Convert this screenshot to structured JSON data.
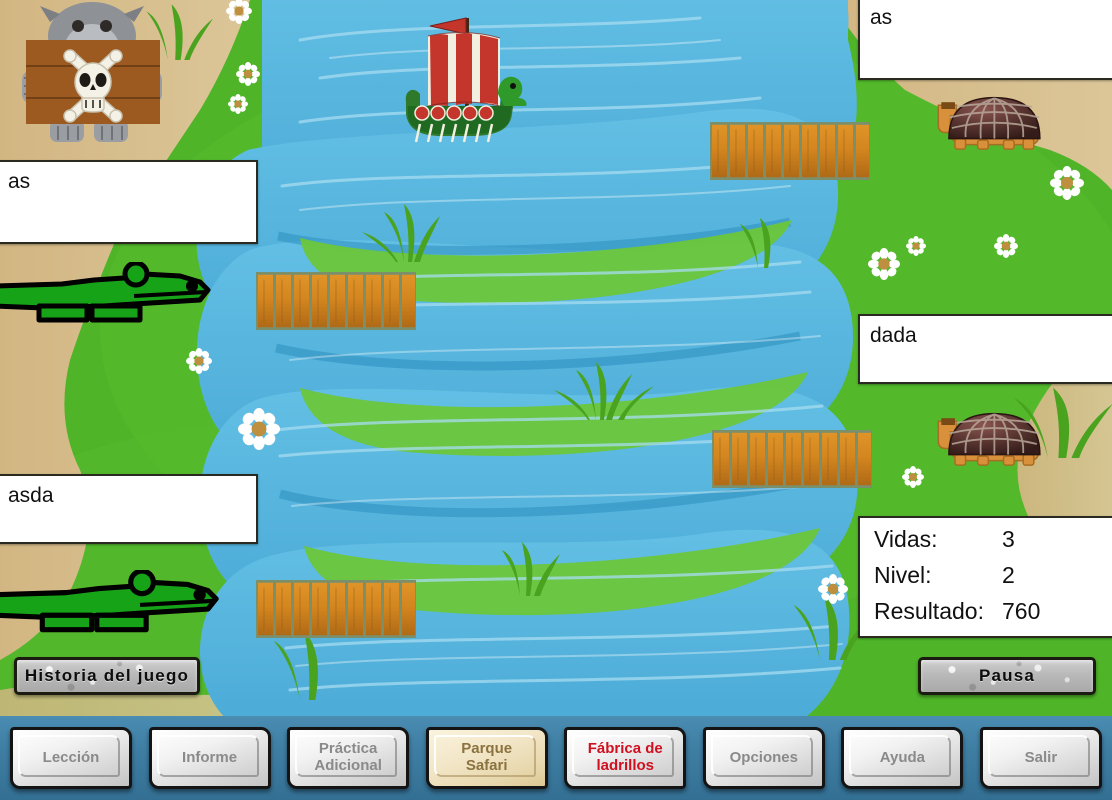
{
  "app": {
    "title": "Parque Safari",
    "scene_name": "river-crossing-safari-scene"
  },
  "colors": {
    "grass": "#4fb428",
    "grass_light": "#6cc63a",
    "sand": "#d9b687",
    "water": "#5cb8e0",
    "water_light": "#9bd8ef",
    "water_deep": "#2e8fbf",
    "bridge_plank": "#d4861f",
    "bridge_plank_dark": "#b06a16",
    "toolbar": "#3d7fa6",
    "active_tab": "#f0e2bb",
    "red_text": "#d01020",
    "panel_bg": "#ffffff",
    "panel_border": "#2a2a20",
    "turtle_shell": "#4a2b28",
    "turtle_body": "#d9903a",
    "croc_body": "#17a318",
    "ape_body": "#8e9196",
    "sign_wood": "#9c5a21"
  },
  "word_boxes": [
    {
      "id": "left-1",
      "value": "as",
      "placeholder": ""
    },
    {
      "id": "left-2",
      "value": "asda",
      "placeholder": ""
    },
    {
      "id": "right-1",
      "value": "as",
      "placeholder": ""
    },
    {
      "id": "right-2",
      "value": "dada",
      "placeholder": ""
    }
  ],
  "score_panel": {
    "rows": [
      {
        "label": "Vidas:",
        "value": "3"
      },
      {
        "label": "Nivel:",
        "value": "2"
      },
      {
        "label": "Resultado:",
        "value": "760"
      }
    ]
  },
  "scene_buttons": {
    "history": "Historia del juego",
    "pause": "Pausa"
  },
  "toolbar": {
    "buttons": [
      {
        "label": "Lección",
        "lines": [
          "Lección"
        ],
        "state": "normal"
      },
      {
        "label": "Informe",
        "lines": [
          "Informe"
        ],
        "state": "normal"
      },
      {
        "label": "Práctica Adicional",
        "lines": [
          "Práctica",
          "Adicional"
        ],
        "state": "normal"
      },
      {
        "label": "Parque Safari",
        "lines": [
          "Parque",
          "Safari"
        ],
        "state": "active"
      },
      {
        "label": "Fábrica de ladrillos",
        "lines": [
          "Fábrica de",
          "ladrillos"
        ],
        "state": "red"
      },
      {
        "label": "Opciones",
        "lines": [
          "Opciones"
        ],
        "state": "normal"
      },
      {
        "label": "Ayuda",
        "lines": [
          "Ayuda"
        ],
        "state": "normal"
      },
      {
        "label": "Salir",
        "lines": [
          "Salir"
        ],
        "state": "normal"
      }
    ]
  },
  "sprites": {
    "ship": {
      "name": "viking-longship",
      "sail_colors": [
        "#c4352b",
        "#f2eee0"
      ]
    },
    "crocodiles": [
      {
        "name": "crocodile-upper",
        "facing": "right"
      },
      {
        "name": "crocodile-lower",
        "facing": "right"
      }
    ],
    "turtles": [
      {
        "name": "turtle-upper",
        "facing": "left"
      },
      {
        "name": "turtle-lower",
        "facing": "left"
      }
    ],
    "ape_sign": {
      "name": "ape-skull-sign",
      "symbol": "skull-and-crossbones"
    },
    "bridges": [
      {
        "name": "bridge-top-right"
      },
      {
        "name": "bridge-middle-left"
      },
      {
        "name": "bridge-middle-right"
      },
      {
        "name": "bridge-bottom-left"
      }
    ],
    "flowers_count": 10
  }
}
